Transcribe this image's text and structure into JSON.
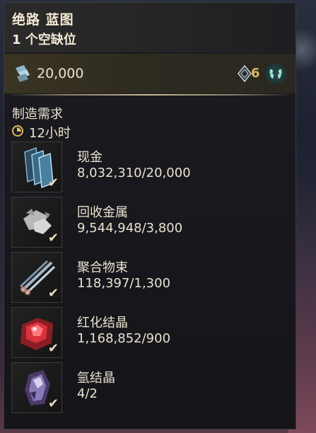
{
  "panel": {
    "title": "绝路 蓝图",
    "subtitle": "1 个空缺位"
  },
  "cost": {
    "credits_icon": "credits-icon",
    "credits_value": "20,000",
    "mastery_icon": "mastery-rank-icon",
    "mastery_value": "6",
    "wreath_icon": "laurel-wreath-icon"
  },
  "requirements": {
    "header": "制造需求",
    "time_icon": "clock-icon",
    "time": "12小时",
    "items": [
      {
        "name": "现金",
        "quantity": "8,032,310/20,000",
        "icon": "credits-stack-icon",
        "met": true
      },
      {
        "name": "回收金属",
        "quantity": "9,544,948/3,800",
        "icon": "salvage-icon",
        "met": true
      },
      {
        "name": "聚合物束",
        "quantity": "118,397/1,300",
        "icon": "polymer-bundle-icon",
        "met": true
      },
      {
        "name": "红化结晶",
        "quantity": "1,168,852/900",
        "icon": "rubedo-icon",
        "met": true
      },
      {
        "name": "氩结晶",
        "quantity": "4/2",
        "icon": "argon-crystal-icon",
        "met": true
      }
    ],
    "check_glyph": "✔"
  },
  "colors": {
    "accent_gold": "#d9b860",
    "text_cream": "#e9e2cf",
    "wreath_teal": "#7fd6c8"
  }
}
